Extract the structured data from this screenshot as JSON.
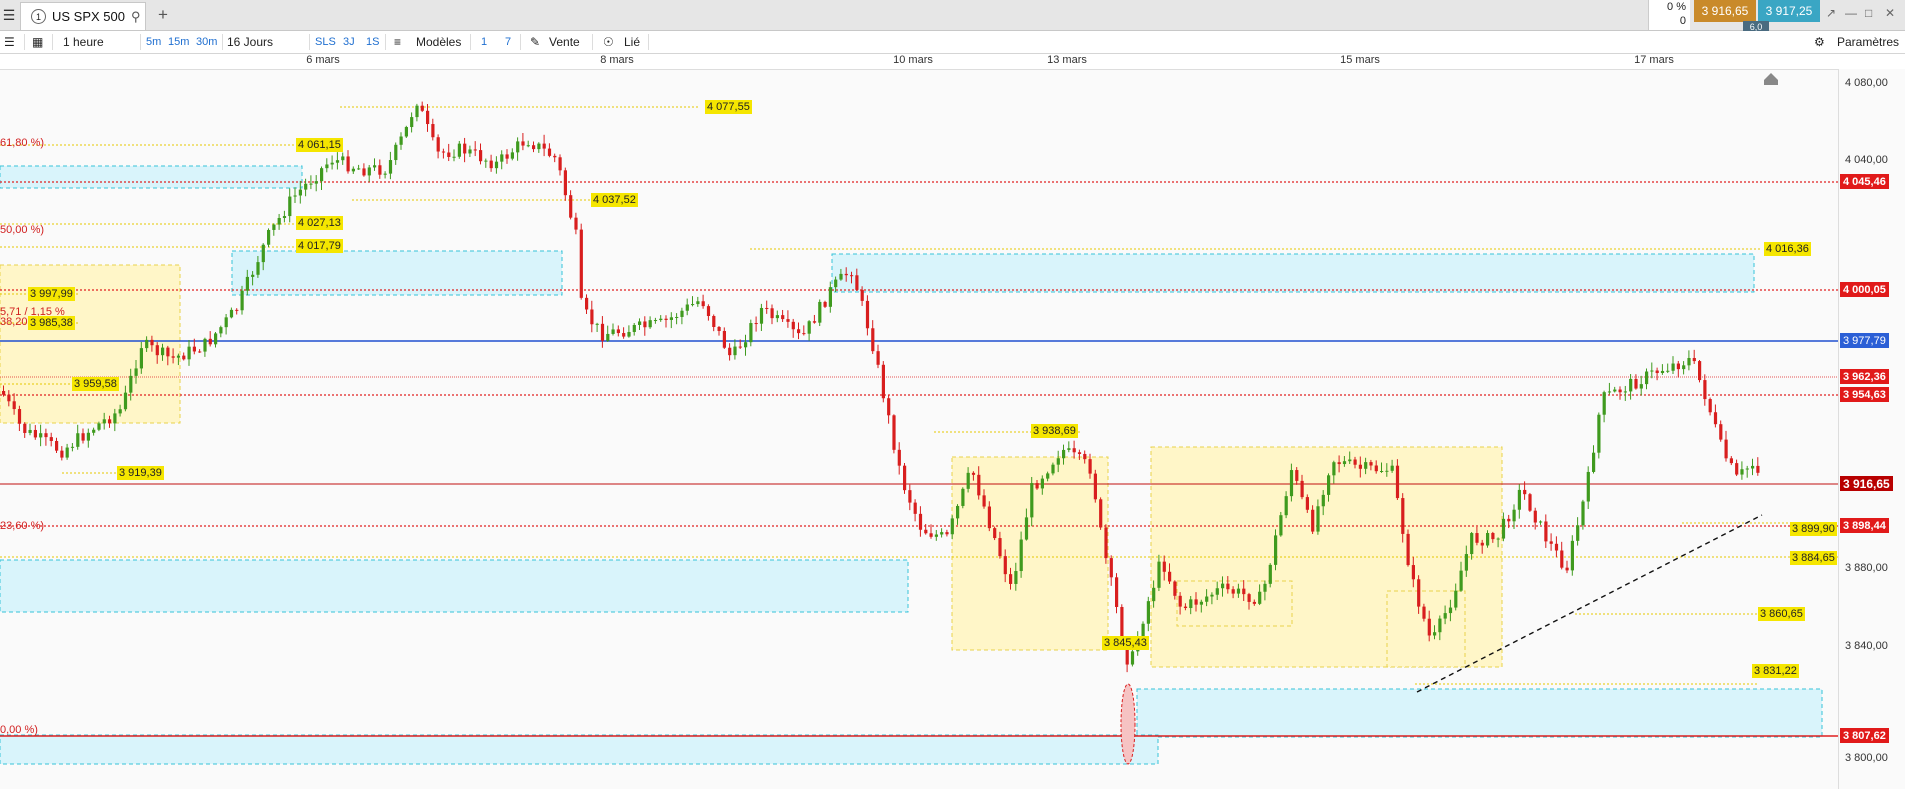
{
  "topbar": {
    "menu_icon": "hamburger-icon",
    "tab_number": "1",
    "tab_title": "US SPX 500",
    "add_tab": "+",
    "change_pct": "0 %",
    "change_val": "0",
    "bid": "3 916,65",
    "ask": "3 917,25",
    "spread": "6,0"
  },
  "toolbar": {
    "interval": "1 heure",
    "tf_5m": "5m",
    "tf_15m": "15m",
    "tf_30m": "30m",
    "range": "16 Jours",
    "sls": "SLS",
    "three_j": "3J",
    "one_s": "1S",
    "models": "Modèles",
    "one": "1",
    "seven": "7",
    "sell": "Vente",
    "linked": "Lié",
    "settings": "Paramètres"
  },
  "dates": [
    "6 mars",
    "8 mars",
    "10 mars",
    "13 mars",
    "15 mars",
    "17 mars"
  ],
  "price_ticks": [
    "4 080,00",
    "4 040,00",
    "3 880,00",
    "3 840,00",
    "3 800,00"
  ],
  "axis_labels": {
    "l1": "4 045,46",
    "l2": "4 000,05",
    "l3": "3 977,79",
    "l4": "3 962,36",
    "l5": "3 954,63",
    "l6": "3 916,65",
    "l7": "3 898,44",
    "l8": "3 807,62"
  },
  "annotations": {
    "a1": "4 077,55",
    "a2": "4 061,15",
    "a3": "4 037,52",
    "a4": "4 027,13",
    "a5": "4 017,79",
    "a6": "4 016,36",
    "a7": "3 997,99",
    "a8": "3 985,38",
    "a9": "3 959,58",
    "a10": "3 919,39",
    "a11": "3 938,69",
    "a12": "3 899,90",
    "a13": "3 884,65",
    "a14": "3 860,65",
    "a15": "3 845,43",
    "a16": "3 831,22"
  },
  "fib_labels": {
    "f1": "61,80 %)",
    "f2": "50,00 %)",
    "f3": "5,71 / 1,15 %",
    "f4": "38,20 %)",
    "f5": "23,60 %)",
    "f6": "0,00 %)"
  },
  "colors": {
    "up": "#3f9a1e",
    "down": "#d81e1e",
    "cyan_zone": "#d9f4fb",
    "yellow_zone": "#fff6c8",
    "blue_line": "#1f4fd0",
    "red_line": "#e02020",
    "axis_red": "#e11a1a",
    "axis_blue": "#2b5fd6",
    "axis_darkred": "#b80000"
  }
}
